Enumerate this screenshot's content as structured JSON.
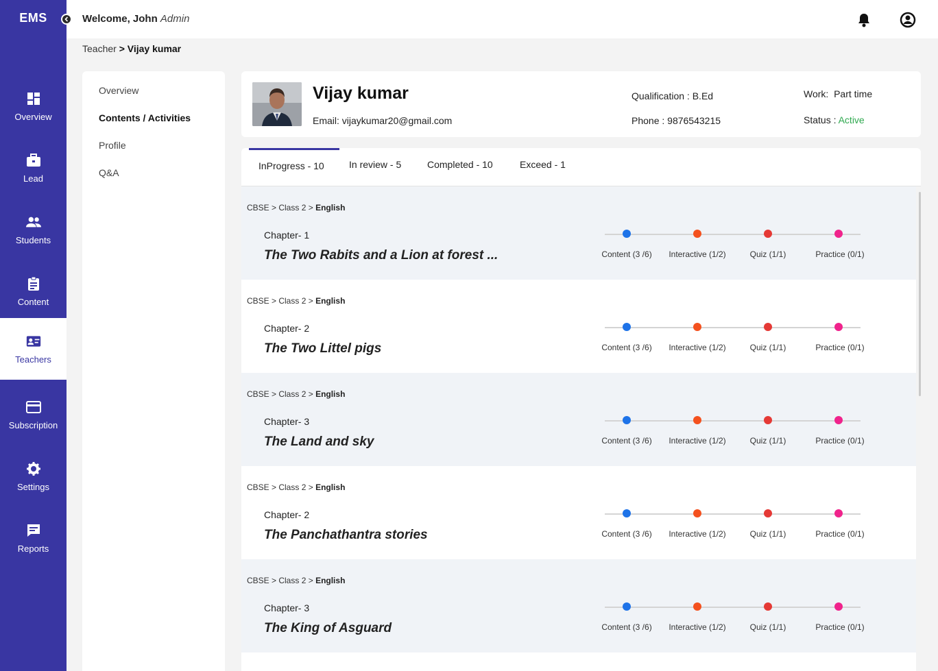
{
  "app": {
    "logo": "EMS"
  },
  "header": {
    "welcome_prefix": "Welcome, John",
    "welcome_role": "Admin"
  },
  "sidebar": {
    "items": [
      {
        "label": "Overview",
        "icon": "dashboard-icon"
      },
      {
        "label": "Lead",
        "icon": "briefcase-icon"
      },
      {
        "label": "Students",
        "icon": "people-icon"
      },
      {
        "label": "Content",
        "icon": "clipboard-icon"
      },
      {
        "label": "Teachers",
        "icon": "id-card-icon",
        "active": true
      },
      {
        "label": "Subscription",
        "icon": "card-icon"
      },
      {
        "label": "Settings",
        "icon": "gear-icon"
      },
      {
        "label": "Reports",
        "icon": "chat-icon"
      }
    ]
  },
  "breadcrumb": {
    "parent": "Teacher",
    "separator": ">",
    "current": "Vijay kumar"
  },
  "submenu": {
    "items": [
      {
        "label": "Overview"
      },
      {
        "label": "Contents / Activities",
        "active": true
      },
      {
        "label": "Profile"
      },
      {
        "label": "Q&A"
      }
    ]
  },
  "profile": {
    "name": "Vijay kumar",
    "email_label": "Email:",
    "email": "vijaykumar20@gmail.com",
    "qualification_label": "Qualification :",
    "qualification": "B.Ed",
    "phone_label": "Phone :",
    "phone": "9876543215",
    "work_label": "Work:",
    "work": "Part time",
    "status_label": "Status :",
    "status": "Active",
    "status_color": "#2fa84f"
  },
  "tabs": [
    {
      "label": "InProgress - 10",
      "active": true
    },
    {
      "label": "In review - 5"
    },
    {
      "label": "Completed - 10"
    },
    {
      "label": "Exceed - 1"
    }
  ],
  "progress_colors": {
    "content": "#1e73e8",
    "interactive": "#f4511e",
    "quiz": "#e53935",
    "practice": "#f0238c"
  },
  "chapters": [
    {
      "path": "CBSE > Class 2 >",
      "subject": "English",
      "number": "Chapter- 1",
      "title": "The Two Rabits and a Lion at forest ...",
      "steps": [
        "Content (3 /6)",
        "Interactive (1/2)",
        "Quiz (1/1)",
        "Practice (0/1)"
      ]
    },
    {
      "path": "CBSE > Class 2 >",
      "subject": "English",
      "number": "Chapter- 2",
      "title": "The Two Littel pigs",
      "steps": [
        "Content (3 /6)",
        "Interactive (1/2)",
        "Quiz (1/1)",
        "Practice (0/1)"
      ]
    },
    {
      "path": "CBSE > Class 2 >",
      "subject": "English",
      "number": "Chapter- 3",
      "title": "The Land and sky",
      "steps": [
        "Content (3 /6)",
        "Interactive (1/2)",
        "Quiz (1/1)",
        "Practice (0/1)"
      ]
    },
    {
      "path": "CBSE > Class 2 >",
      "subject": "English",
      "number": "Chapter- 2",
      "title": "The Panchathantra stories",
      "steps": [
        "Content (3 /6)",
        "Interactive (1/2)",
        "Quiz (1/1)",
        "Practice (0/1)"
      ]
    },
    {
      "path": "CBSE > Class 2 >",
      "subject": "English",
      "number": "Chapter- 3",
      "title": "The King of Asguard",
      "steps": [
        "Content (3 /6)",
        "Interactive (1/2)",
        "Quiz (1/1)",
        "Practice (0/1)"
      ]
    }
  ]
}
